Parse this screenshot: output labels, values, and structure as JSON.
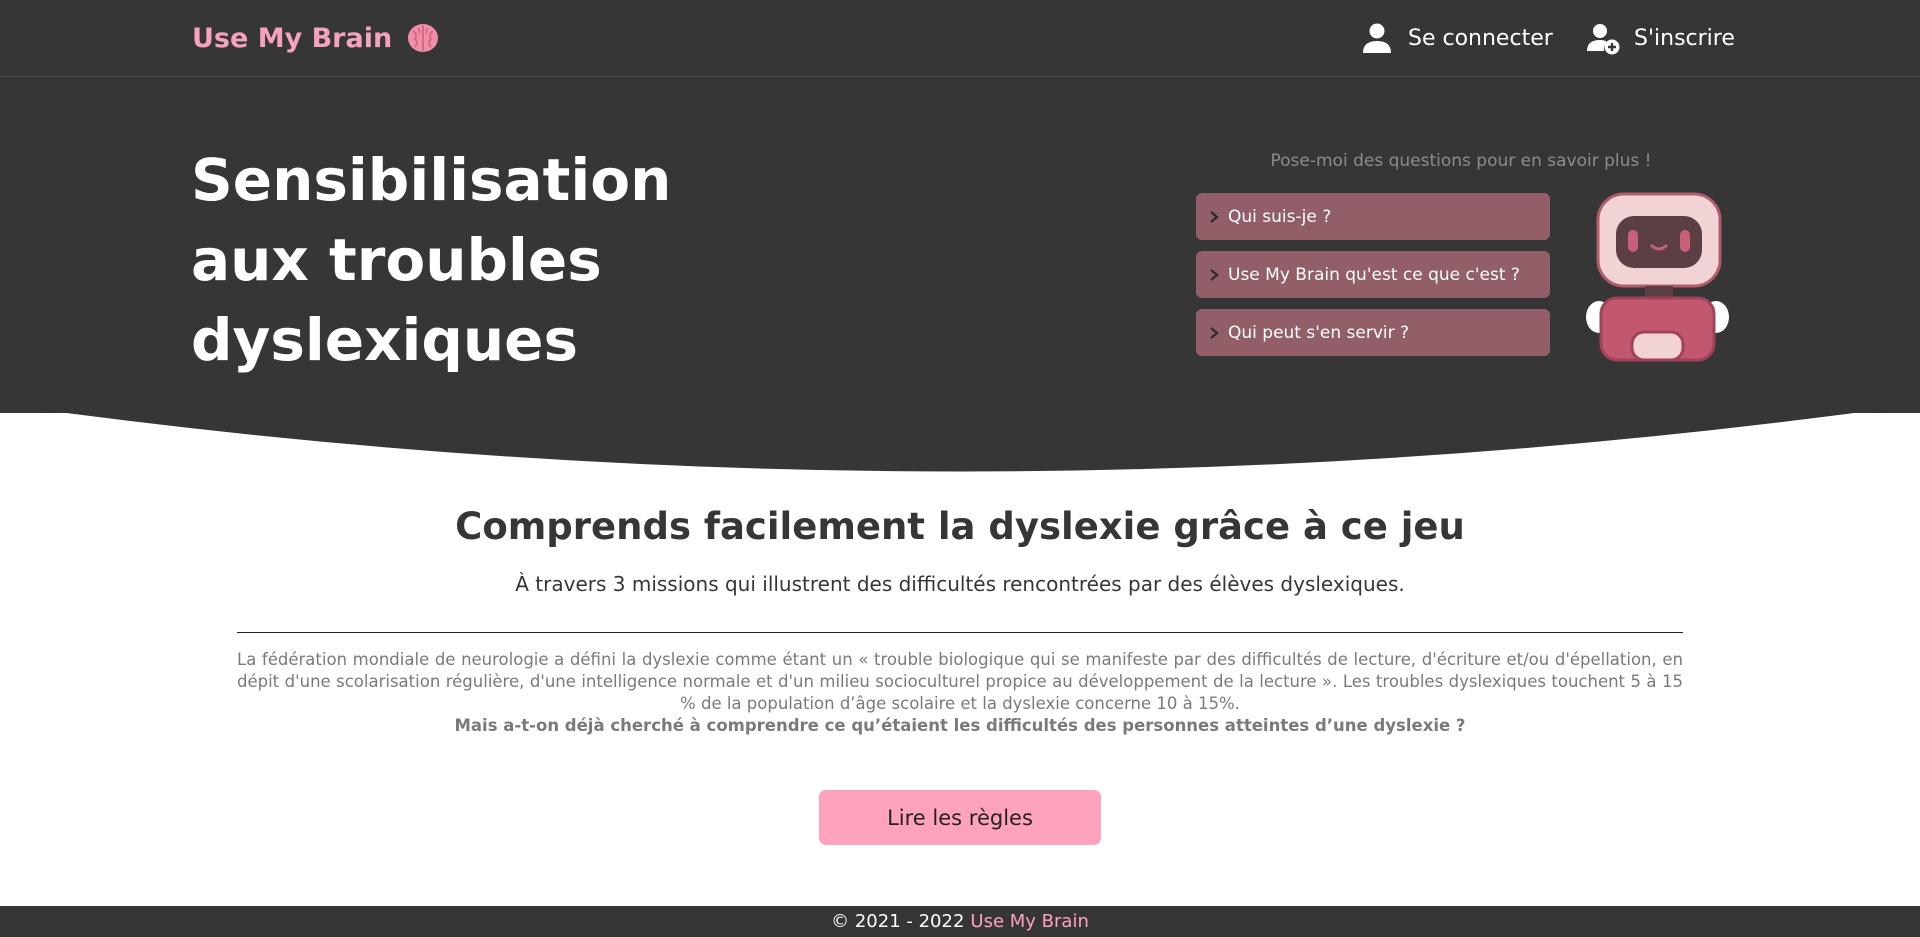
{
  "header": {
    "brand": "Use My Brain",
    "brand_icon": "brain-icon",
    "login_label": "Se connecter",
    "login_icon": "user-icon",
    "signup_label": "S'inscrire",
    "signup_icon": "user-add-icon"
  },
  "hero": {
    "title_line1": "Sensibilisation",
    "title_line2": "aux troubles",
    "title_line3": "dyslexiques",
    "chat_prompt": "Pose-moi des questions pour en savoir plus !",
    "faq": [
      "Qui suis-je ?",
      "Use My Brain qu'est ce que c'est ?",
      "Qui peut s'en servir ?"
    ]
  },
  "main": {
    "title": "Comprends facilement la dyslexie grâce à ce jeu",
    "subtitle": "À travers 3 missions qui illustrent des difficultés rencontrées par des élèves dyslexiques.",
    "paragraph": "La fédération mondiale de neurologie a défini la dyslexie comme étant un « trouble biologique qui se manifeste par des difficultés de lecture, d'écriture et/ou d'épellation, en dépit d'une scolarisation régulière, d'une intelligence normale et d'un milieu socioculturel propice au développement de la lecture ». Les troubles dyslexiques touchent 5 à 15 % de la population d’âge scolaire et la dyslexie concerne 10 à 15%.",
    "question": "Mais a-t-on déjà cherché à comprendre ce qu’étaient les difficultés des personnes atteintes d’une dyslexie ?",
    "rules_button": "Lire les règles"
  },
  "footer": {
    "copyright": "© 2021 - 2022",
    "brand": "Use My Brain"
  },
  "colors": {
    "dark": "#363636",
    "pink": "#ffa3bd",
    "mauve": "#925f69"
  }
}
